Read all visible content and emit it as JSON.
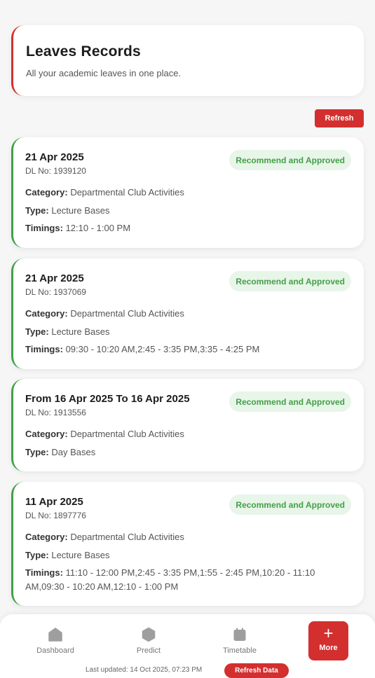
{
  "header": {
    "title": "Leaves Records",
    "subtitle": "All your academic leaves in one place."
  },
  "refresh_label": "Refresh",
  "labels": {
    "category": "Category:",
    "type": "Type:",
    "timings": "Timings:"
  },
  "leaves": [
    {
      "date": "21 Apr 2025",
      "dl_no": "DL No: 1939120",
      "status": "Recommend and Approved",
      "category": "Departmental Club Activities",
      "type": "Lecture Bases",
      "timings": "12:10 - 1:00 PM"
    },
    {
      "date": "21 Apr 2025",
      "dl_no": "DL No: 1937069",
      "status": "Recommend and Approved",
      "category": "Departmental Club Activities",
      "type": "Lecture Bases",
      "timings": "09:30 - 10:20 AM,2:45 - 3:35 PM,3:35 - 4:25 PM"
    },
    {
      "date": "From 16 Apr 2025 To 16 Apr 2025",
      "dl_no": "DL No: 1913556",
      "status": "Recommend and Approved",
      "category": "Departmental Club Activities",
      "type": "Day Bases"
    },
    {
      "date": "11 Apr 2025",
      "dl_no": "DL No: 1897776",
      "status": "Recommend and Approved",
      "category": "Departmental Club Activities",
      "type": "Lecture Bases",
      "timings": "11:10 - 12:00 PM,2:45 - 3:35 PM,1:55 - 2:45 PM,10:20 - 11:10 AM,09:30 - 10:20 AM,12:10 - 1:00 PM"
    }
  ],
  "nav": {
    "dashboard": "Dashboard",
    "predict": "Predict",
    "timetable": "Timetable",
    "more": "More",
    "more_icon": "+"
  },
  "footer": {
    "last_updated": "Last updated: 14 Oct 2025, 07:23 PM",
    "refresh_data": "Refresh Data"
  },
  "colors": {
    "accent": "#d32f2f",
    "approved": "#43a047",
    "approved_bg": "#e8f5e9"
  }
}
